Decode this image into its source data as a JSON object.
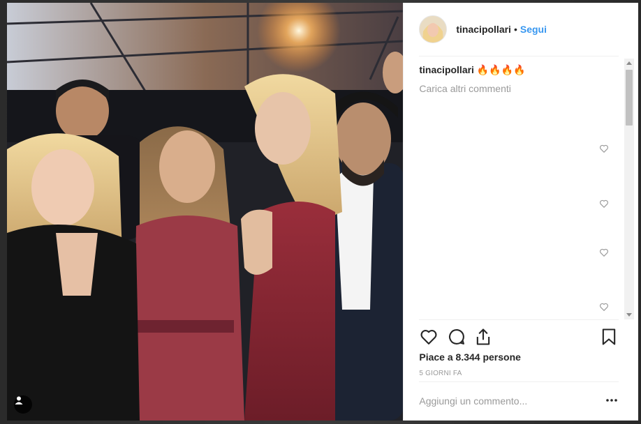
{
  "post": {
    "username": "tinacipollari",
    "dot": "•",
    "follow_label": "Segui",
    "caption_user": "tinacipollari",
    "caption_text": "🔥🔥🔥🔥",
    "load_more": "Carica altri commenti",
    "likes": "Piace a 8.344 persone",
    "time": "5 GIORNI FA",
    "comment_placeholder": "Aggiungi un commento..."
  },
  "icons": {
    "like": "heart-icon",
    "comment": "comment-icon",
    "share": "share-icon",
    "save": "bookmark-icon",
    "more": "more-options-icon",
    "tag": "user-tag-icon"
  },
  "colors": {
    "accent": "#3897f0",
    "text": "#262626",
    "muted": "#999999"
  }
}
